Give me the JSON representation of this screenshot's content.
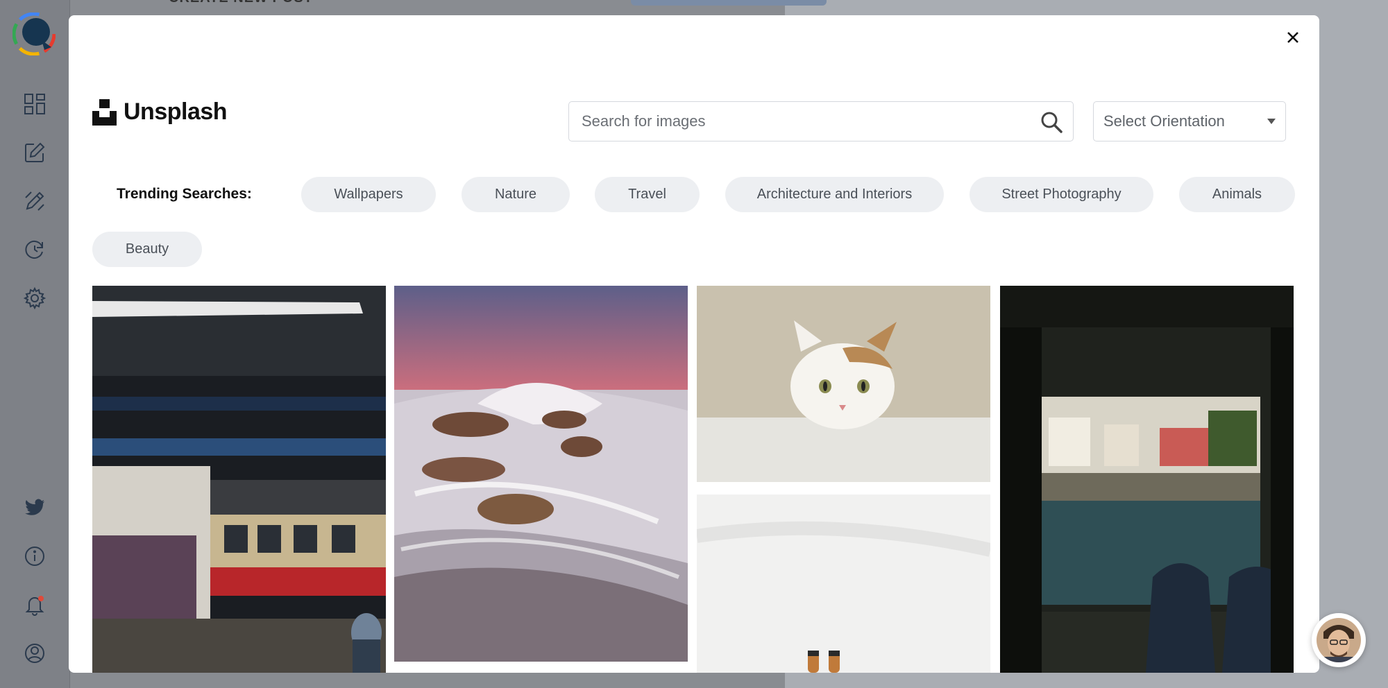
{
  "background_page": {
    "header": "CREATE NEW POST"
  },
  "sidebar": {
    "items": [
      {
        "name": "dashboard-icon"
      },
      {
        "name": "edit-icon"
      },
      {
        "name": "pen-icon"
      },
      {
        "name": "refresh-icon"
      },
      {
        "name": "gear-icon"
      },
      {
        "name": "twitter-icon"
      },
      {
        "name": "info-icon"
      },
      {
        "name": "bell-icon"
      },
      {
        "name": "user-icon"
      }
    ]
  },
  "modal": {
    "brand": "Unsplash",
    "search": {
      "placeholder": "Search for images",
      "value": ""
    },
    "orientation": {
      "selected": "Select Orientation"
    },
    "trending_label": "Trending Searches:",
    "tags": [
      "Wallpapers",
      "Nature",
      "Travel",
      "Architecture and Interiors",
      "Street Photography",
      "Animals",
      "Beauty"
    ]
  },
  "colors": {
    "accent_blue": "#1b3a5c",
    "tag_bg": "#edeff2",
    "overlay": "#a9adb3"
  }
}
